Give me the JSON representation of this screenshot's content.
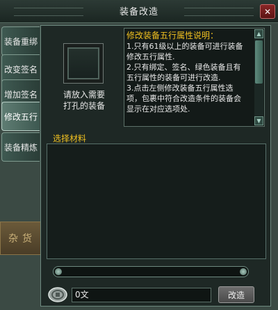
{
  "window": {
    "title": "装备改造",
    "close_glyph": "✕"
  },
  "tabs": [
    {
      "label": "装备重绑",
      "active": false
    },
    {
      "label": "改变签名",
      "active": false
    },
    {
      "label": "增加签名",
      "active": false
    },
    {
      "label": "修改五行",
      "active": true
    },
    {
      "label": "装备精炼",
      "active": false
    }
  ],
  "slot": {
    "hint_line1": "请放入需要",
    "hint_line2": "打孔的装备"
  },
  "description": {
    "title": "修改装备五行属性说明：",
    "lines": [
      "1.只有61级以上的装备可进行装备",
      "修改五行属性.",
      "2.只有绑定、签名、绿色装备且有",
      "五行属性的装备可进行改造.",
      "3.点击左侧修改装备五行属性选",
      "项，包裹中符合改造条件的装备会",
      "显示在对应选项处."
    ]
  },
  "materials": {
    "label": "选择材料"
  },
  "cost": {
    "value": "0文",
    "icon": "coin-icon"
  },
  "confirm_button": {
    "label": "改造"
  },
  "background": {
    "sign_text": "杂货"
  },
  "colors": {
    "title_yellow": "#f0c020",
    "panel": "#1e2825",
    "border": "#6e8a80"
  }
}
